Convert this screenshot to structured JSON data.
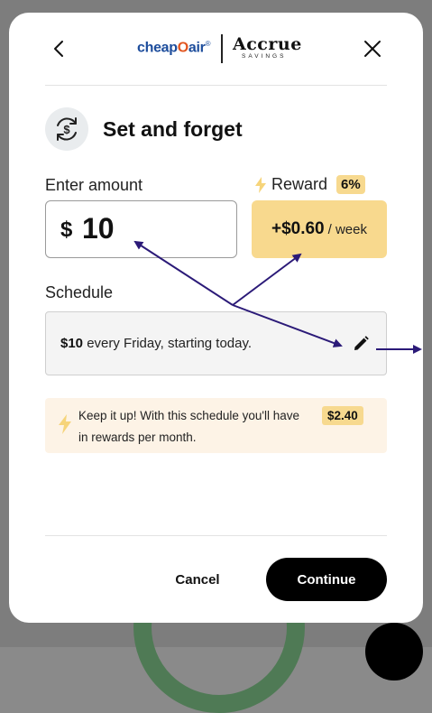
{
  "header": {
    "brand_partner": "cheap",
    "brand_partner_o": "O",
    "brand_partner_rest": "air",
    "brand_partner_mark": "®",
    "brand_main": "Accrue",
    "brand_main_sub": "SAVINGS"
  },
  "title": "Set and forget",
  "amount": {
    "label": "Enter amount",
    "currency": "$",
    "value": "10"
  },
  "reward": {
    "label": "Reward",
    "percent": "6%",
    "amount": "+$0.60",
    "unit": "/ week"
  },
  "schedule": {
    "label": "Schedule",
    "amount": "$10",
    "text": " every Friday, starting today."
  },
  "tip": {
    "line1": "Keep it up! With this schedule you'll have",
    "badge": "$2.40",
    "line2": "in rewards per month."
  },
  "buttons": {
    "cancel": "Cancel",
    "continue": "Continue"
  },
  "colors": {
    "accent_yellow": "#f8d98e",
    "tip_bg": "#fdf3e6",
    "annotation_arrow": "#2b1a78",
    "primary_button": "#000000"
  }
}
